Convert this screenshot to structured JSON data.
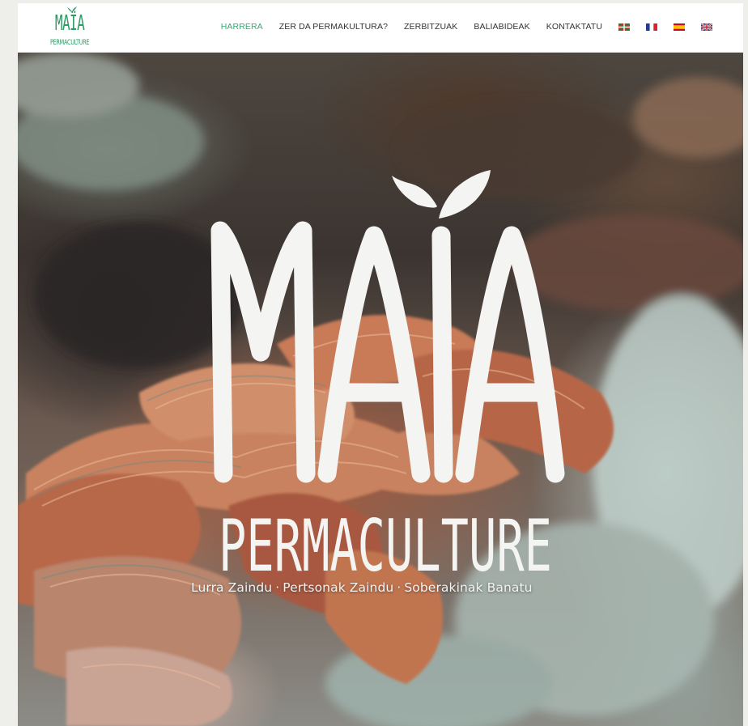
{
  "header": {
    "logo": {
      "word": "MAÏA",
      "sub": "PERMACULTURE",
      "color": "#2f9a65"
    },
    "nav": {
      "items": [
        {
          "label": "HARRERA",
          "active": true
        },
        {
          "label": "ZER DA PERMAKULTURA?",
          "active": false
        },
        {
          "label": "ZERBITZUAK",
          "active": false
        },
        {
          "label": "BALIABIDEAK",
          "active": false
        },
        {
          "label": "KONTAKTATU",
          "active": false
        }
      ],
      "languages": [
        "basque-flag-icon",
        "french-flag-icon",
        "spanish-flag-icon",
        "uk-flag-icon"
      ],
      "active_color": "#3aa873"
    }
  },
  "hero": {
    "title": "MAÏA",
    "subtitle": "PERMACULTURE",
    "tagline": [
      "Lurra Zaindu",
      "Pertsonak Zaindu",
      "Soberakinak Banatu"
    ],
    "tagline_separator": "·",
    "image": "turkey-tail-mushroom-photo"
  }
}
